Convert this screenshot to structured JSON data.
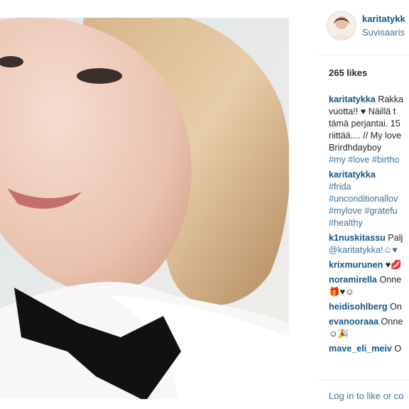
{
  "post": {
    "username": "karitatykk",
    "location": "Suvisaaris",
    "likes": "265 likes",
    "login_prompt": "Log in to like or co"
  },
  "comments": [
    {
      "user": "karitatykka",
      "parts": [
        {
          "t": " Rakka"
        },
        {
          "t": "vuotta!! ♥ Näillä t"
        },
        {
          "t": "tämä perjantai. 15"
        },
        {
          "t": "riittää.... // My love"
        },
        {
          "t": "Brirdhdayboy"
        },
        {
          "t": "#my #love #birtho",
          "tag": true
        }
      ]
    },
    {
      "user": "karitatykka",
      "parts": [
        {
          "t": " "
        },
        {
          "t": "#frida",
          "tag": true
        },
        {
          "t": "#unconditionallov",
          "tag": true
        },
        {
          "t": "#mylove #gratefu",
          "tag": true
        },
        {
          "t": "#healthy",
          "tag": true
        }
      ]
    },
    {
      "user": "k1nuskitassu",
      "parts": [
        {
          "t": " Palj"
        },
        {
          "t": "@karitatykka!☺♥",
          "tag": true
        }
      ]
    },
    {
      "user": "krixmurunen",
      "parts": [
        {
          "t": " ♥💋"
        }
      ]
    },
    {
      "user": "noramirella",
      "parts": [
        {
          "t": " Onne"
        },
        {
          "t": "🎁♥☺"
        }
      ]
    },
    {
      "user": "heidisohlberg",
      "parts": [
        {
          "t": " On"
        }
      ]
    },
    {
      "user": "evanooraaa",
      "parts": [
        {
          "t": " Onne"
        },
        {
          "t": "☺🎉"
        }
      ]
    },
    {
      "user": "mave_eli_meiv",
      "parts": [
        {
          "t": " O"
        }
      ]
    }
  ]
}
